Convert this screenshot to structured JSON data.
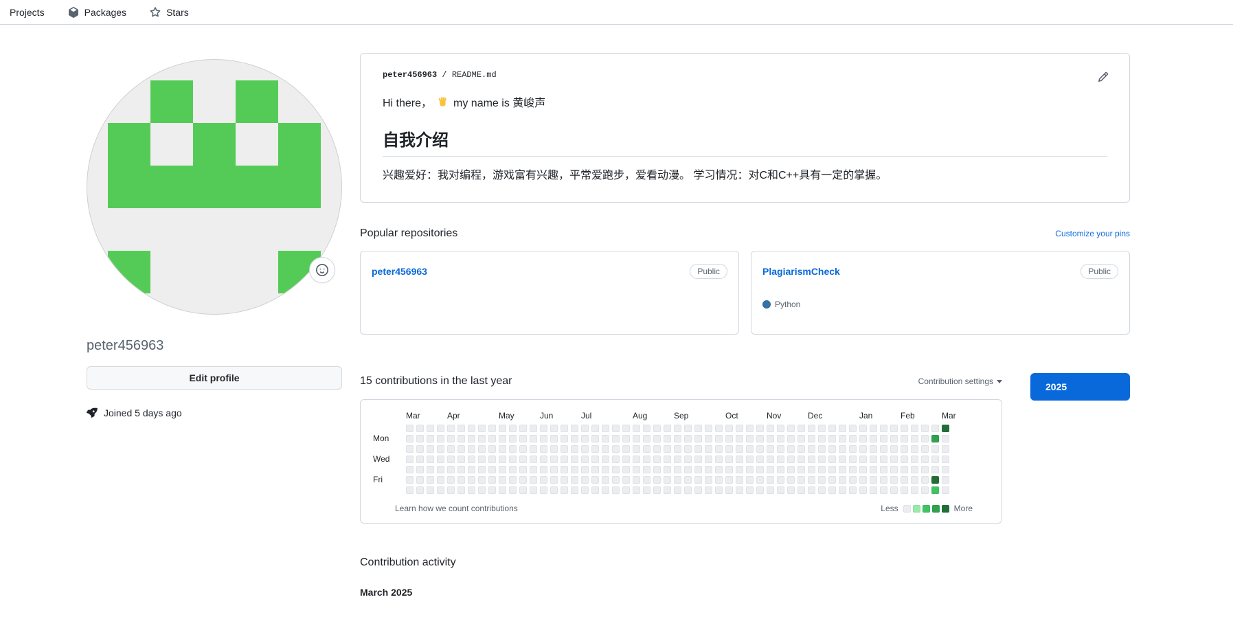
{
  "tabs": {
    "projects": "Projects",
    "packages": "Packages",
    "stars": "Stars"
  },
  "colors": {
    "accent": "#0969da",
    "link": "#0969da",
    "border": "#d0d7de",
    "muted_text": "#59636e"
  },
  "profile": {
    "username": "peter456963",
    "edit_button": "Edit profile",
    "joined": "Joined 5 days ago",
    "avatar": {
      "bg": "#eeeeee",
      "fg": "#55cb57",
      "pattern": [
        [
          0,
          1,
          0,
          1,
          0
        ],
        [
          1,
          0,
          1,
          0,
          1
        ],
        [
          1,
          1,
          1,
          1,
          1
        ],
        [
          0,
          0,
          0,
          0,
          0
        ],
        [
          1,
          0,
          0,
          0,
          1
        ]
      ]
    }
  },
  "readme": {
    "path_owner": "peter456963",
    "path_sep": " / ",
    "path_file": "README.md",
    "greeting_pre": "Hi there，",
    "greeting_post": "my name is 黄峻声",
    "wave_icon": "waving-hand-emoji",
    "heading": "自我介绍",
    "body": "兴趣爱好：我对编程，游戏富有兴趣，平常爱跑步，爱看动漫。 学习情况：对C和C++具有一定的掌握。"
  },
  "popular": {
    "title": "Popular repositories",
    "customize_link": "Customize your pins",
    "repos": [
      {
        "name": "peter456963",
        "visibility": "Public",
        "language": null,
        "language_color": null
      },
      {
        "name": "PlagiarismCheck",
        "visibility": "Public",
        "language": "Python",
        "language_color": "#3572A5"
      }
    ]
  },
  "contributions": {
    "summary": "15 contributions in the last year",
    "settings_label": "Contribution settings",
    "year_button": "2025",
    "weeks": 53,
    "months": [
      {
        "label": "Mar",
        "week": 0
      },
      {
        "label": "Apr",
        "week": 4
      },
      {
        "label": "May",
        "week": 9
      },
      {
        "label": "Jun",
        "week": 13
      },
      {
        "label": "Jul",
        "week": 17
      },
      {
        "label": "Aug",
        "week": 22
      },
      {
        "label": "Sep",
        "week": 26
      },
      {
        "label": "Oct",
        "week": 31
      },
      {
        "label": "Nov",
        "week": 35
      },
      {
        "label": "Dec",
        "week": 39
      },
      {
        "label": "Jan",
        "week": 44
      },
      {
        "label": "Feb",
        "week": 48
      },
      {
        "label": "Mar",
        "week": 52
      }
    ],
    "day_labels": [
      {
        "label": "Mon",
        "row": 1
      },
      {
        "label": "Wed",
        "row": 3
      },
      {
        "label": "Fri",
        "row": 5
      }
    ],
    "cells": [
      {
        "week": 52,
        "day": 0,
        "level": 4
      },
      {
        "week": 51,
        "day": 1,
        "level": 3
      },
      {
        "week": 51,
        "day": 5,
        "level": 4
      },
      {
        "week": 51,
        "day": 6,
        "level": 2
      }
    ],
    "footer_link": "Learn how we count contributions",
    "legend": {
      "less": "Less",
      "more": "More",
      "colors": [
        "#ebedf0",
        "#9be9a8",
        "#40c463",
        "#30a14e",
        "#216e39"
      ]
    }
  },
  "activity": {
    "title": "Contribution activity",
    "month_heading": "March 2025"
  }
}
